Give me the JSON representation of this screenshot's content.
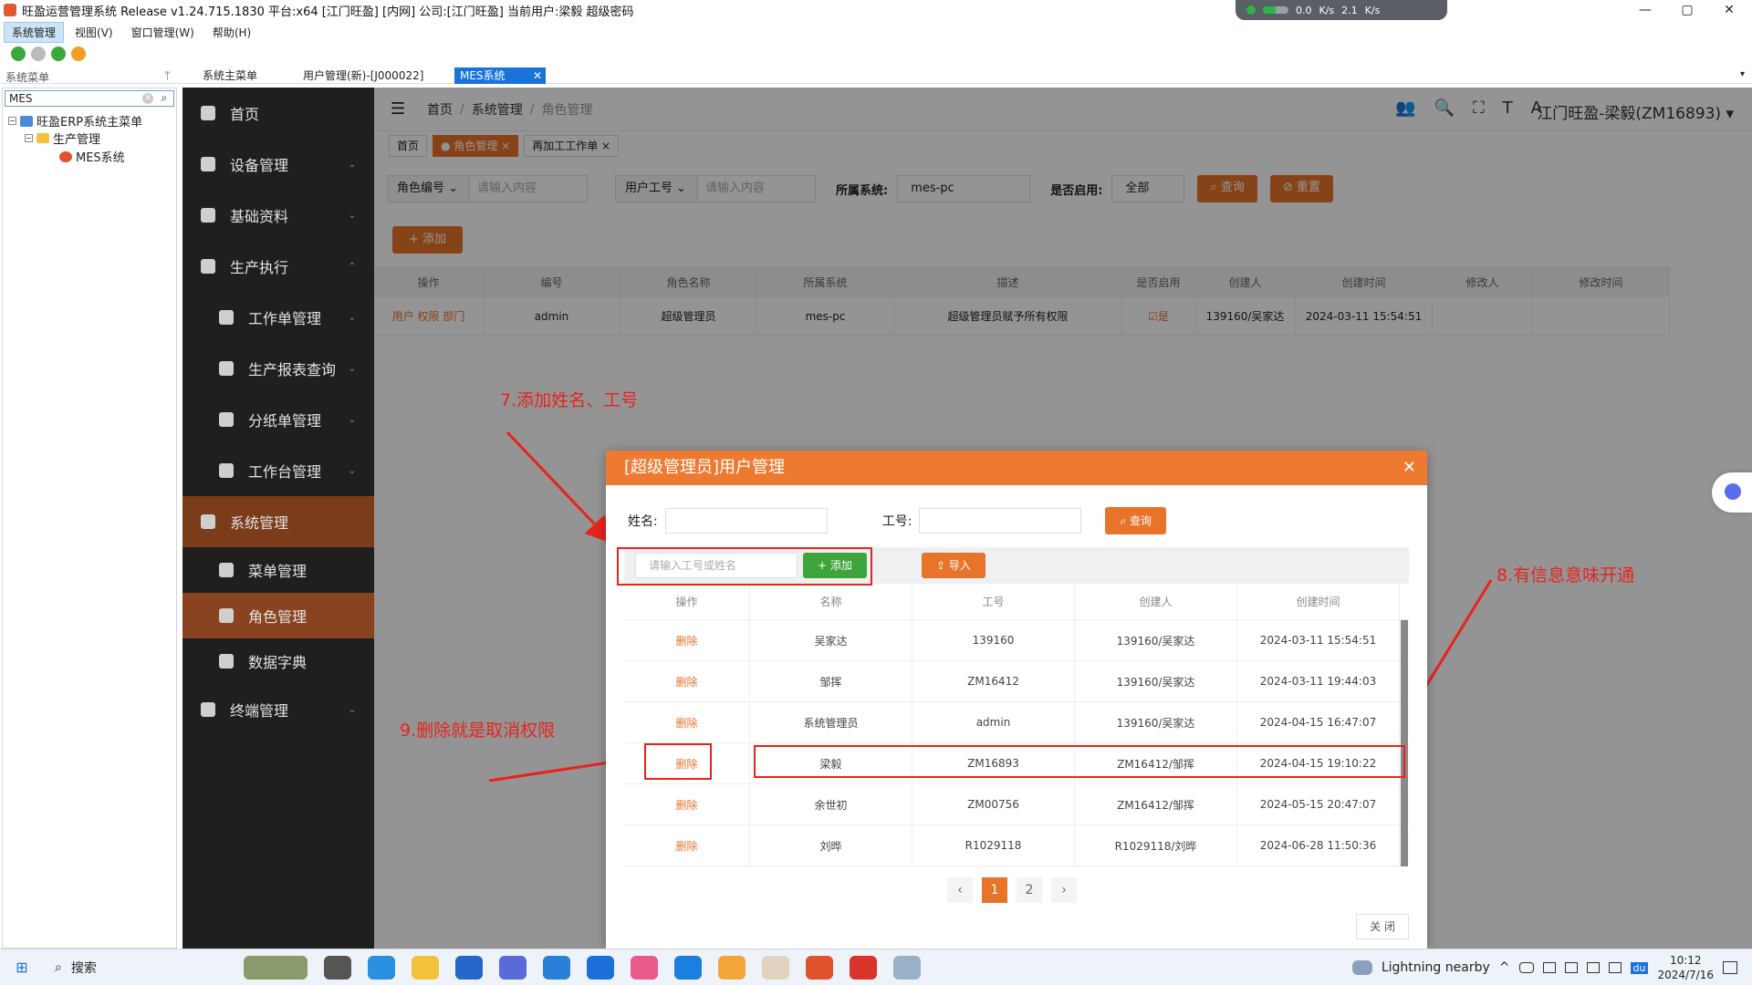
{
  "window": {
    "title": "旺盈运营管理系统 Release v1.24.715.1830 平台:x64  [江门旺盈] [内网] 公司:[江门旺盈] 当前用户:梁毅   超级密码",
    "net_up": "0.0",
    "net_down": "2.1",
    "net_unit": "K/s",
    "minimize": "—",
    "maximize": "▢",
    "close": "✕"
  },
  "menubar": [
    "系统管理",
    "视图(V)",
    "窗口管理(W)",
    "帮助(H)"
  ],
  "tabstrip": {
    "left_title": "系统菜单",
    "pin": "ᛘ",
    "tabs": [
      "系统主菜单",
      "用户管理(新)-[J000022]",
      "MES系统"
    ],
    "close_glyph": "✕",
    "arrow": "▾"
  },
  "tree": {
    "search_value": "MES",
    "clear": "✕",
    "magnifier": "⌕",
    "nodes": [
      "旺盈ERP系统主菜单",
      "生产管理",
      "MES系统"
    ]
  },
  "sidebar": {
    "items": [
      {
        "label": "首页"
      },
      {
        "label": "设备管理"
      },
      {
        "label": "基础资料"
      },
      {
        "label": "生产执行"
      },
      {
        "label": "工作单管理"
      },
      {
        "label": "生产报表查询"
      },
      {
        "label": "分纸单管理"
      },
      {
        "label": "工作台管理"
      },
      {
        "label": "系统管理"
      },
      {
        "label": "菜单管理"
      },
      {
        "label": "角色管理"
      },
      {
        "label": "数据字典"
      },
      {
        "label": "终端管理"
      }
    ],
    "chevron_down": "⌄",
    "chevron_up": "⌃"
  },
  "topnav": {
    "hamburger": "☰",
    "breadcrumb": [
      "首页",
      "系统管理",
      "角色管理"
    ],
    "sep": "/",
    "icons": [
      "👥",
      "🔍",
      "⛶",
      "T",
      "A"
    ],
    "user": "江门旺盈-梁毅(ZM16893)",
    "user_caret": "▾"
  },
  "pagetabs": [
    "首页",
    "角色管理",
    "再加工工作单"
  ],
  "filters": {
    "role_code_select": "角色编号",
    "role_code_placeholder": "请输入内容",
    "user_no_select": "用户工号",
    "user_no_placeholder": "请输入内容",
    "system_label": "所属系统:",
    "system_value": "mes-pc",
    "enabled_label": "是否启用:",
    "enabled_value": "全部",
    "query": "查询",
    "reset": "重置",
    "caret": "⌄"
  },
  "add_button": "+ 添加",
  "grid": {
    "headers": [
      "操作",
      "编号",
      "角色名称",
      "所属系统",
      "描述",
      "是否启用",
      "创建人",
      "创建时间",
      "修改人",
      "修改时间"
    ],
    "row": {
      "ops": "用户  权限  部门",
      "code": "admin",
      "name": "超级管理员",
      "system": "mes-pc",
      "desc": "超级管理员赋予所有权限",
      "enabled": "是",
      "creator": "139160/吴家达",
      "created": "2024-03-11 15:54:51",
      "modifier": "",
      "modified": ""
    }
  },
  "annotations": {
    "a7": "7.添加姓名、工号",
    "a8": "8.有信息意味开通",
    "a9": "9.删除就是取消权限"
  },
  "modal": {
    "title": "[超级管理员]用户管理",
    "close": "✕",
    "name_label": "姓名:",
    "no_label": "工号:",
    "query": "查询",
    "search_placeholder": "请输入工号或姓名",
    "add": "+ 添加",
    "import": "导入",
    "headers": [
      "操作",
      "名称",
      "工号",
      "创建人",
      "创建时间"
    ],
    "rows": [
      {
        "op": "删除",
        "name": "吴家达",
        "no": "139160",
        "creator": "139160/吴家达",
        "created": "2024-03-11 15:54:51"
      },
      {
        "op": "删除",
        "name": "邹挥",
        "no": "ZM16412",
        "creator": "139160/吴家达",
        "created": "2024-03-11 19:44:03"
      },
      {
        "op": "删除",
        "name": "系统管理员",
        "no": "admin",
        "creator": "139160/吴家达",
        "created": "2024-04-15 16:47:07"
      },
      {
        "op": "删除",
        "name": "梁毅",
        "no": "ZM16893",
        "creator": "ZM16412/邹挥",
        "created": "2024-04-15 19:10:22"
      },
      {
        "op": "删除",
        "name": "余世初",
        "no": "ZM00756",
        "creator": "ZM16412/邹挥",
        "created": "2024-05-15 20:47:07"
      },
      {
        "op": "删除",
        "name": "刘晔",
        "no": "R1029118",
        "creator": "R1029118/刘晔",
        "created": "2024-06-28 11:50:36"
      }
    ],
    "pager": {
      "prev": "‹",
      "pages": [
        "1",
        "2"
      ],
      "next": "›"
    },
    "close_button": "关 闭"
  },
  "taskbar": {
    "start": "⊞",
    "search_icon": "⌕",
    "search": "搜索",
    "weather": "Lightning nearby",
    "time": "10:12",
    "date": "2024/7/16",
    "ime": "du",
    "tray_caret": "^"
  }
}
